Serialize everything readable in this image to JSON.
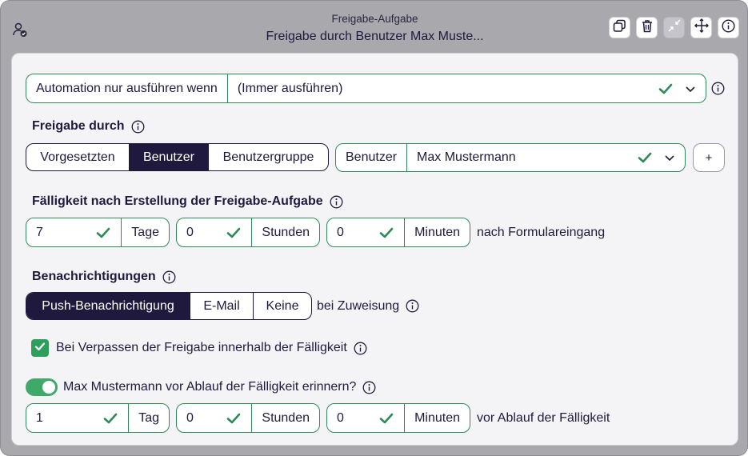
{
  "header": {
    "subtitle": "Freigabe-Aufgabe",
    "title": "Freigabe durch Benutzer Max Muste...",
    "icons": [
      "user-check-icon",
      "copy-icon",
      "trash-icon",
      "collapse-icon",
      "move-icon",
      "info-icon"
    ]
  },
  "automation": {
    "label": "Automation nur ausführen wenn",
    "value": "(Immer ausführen)"
  },
  "approval": {
    "title": "Freigabe durch",
    "options": [
      "Vorgesetzten",
      "Benutzer",
      "Benutzergruppe"
    ],
    "selected": "Benutzer",
    "user_label": "Benutzer",
    "user_value": "Max Mustermann",
    "add_label": "+"
  },
  "due": {
    "title": "Fälligkeit nach Erstellung der Freigabe-Aufgabe",
    "days_value": "7",
    "days_unit": "Tage",
    "hours_value": "0",
    "hours_unit": "Stunden",
    "minutes_value": "0",
    "minutes_unit": "Minuten",
    "suffix": "nach Formulareingang"
  },
  "notifications": {
    "title": "Benachrichtigungen",
    "options": [
      "Push-Benachrichtigung",
      "E-Mail",
      "Keine"
    ],
    "selected": "Push-Benachrichtigung",
    "suffix": "bei Zuweisung"
  },
  "missed": {
    "label": "Bei Verpassen der Freigabe innerhalb der Fälligkeit",
    "checked": true
  },
  "reminder": {
    "label": "Max Mustermann vor Ablauf der Fälligkeit erinnern?",
    "enabled": true,
    "days_value": "1",
    "days_unit": "Tag",
    "hours_value": "0",
    "hours_unit": "Stunden",
    "minutes_value": "0",
    "minutes_unit": "Minuten",
    "suffix": "vor Ablauf der Fälligkeit"
  },
  "colors": {
    "accent": "#1f1a3d",
    "valid": "#2e8b57",
    "window": "#a8a8ad",
    "panel": "#f4f4f6"
  }
}
